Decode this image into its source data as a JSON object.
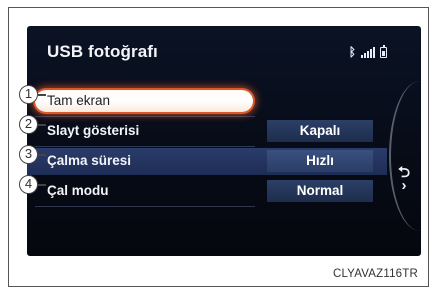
{
  "screen": {
    "title": "USB fotoğrafı",
    "status_icons": [
      "bluetooth-icon",
      "signal-icon",
      "battery-icon"
    ],
    "rows": [
      {
        "callout": "1",
        "label": "Tam ekran",
        "value": null,
        "selected": true
      },
      {
        "callout": "2",
        "label": "Slayt gösterisi",
        "value": "Kapalı"
      },
      {
        "callout": "3",
        "label": "Çalma süresi",
        "value": "Hızlı"
      },
      {
        "callout": "4",
        "label": "Çal modu",
        "value": "Normal"
      }
    ],
    "back_icon": "back-icon"
  },
  "caption": "CLYAVAZ116TR",
  "colors": {
    "highlight": "#d9592b",
    "screen_bg": "#0a1224",
    "value_box": "#2c3f66"
  }
}
